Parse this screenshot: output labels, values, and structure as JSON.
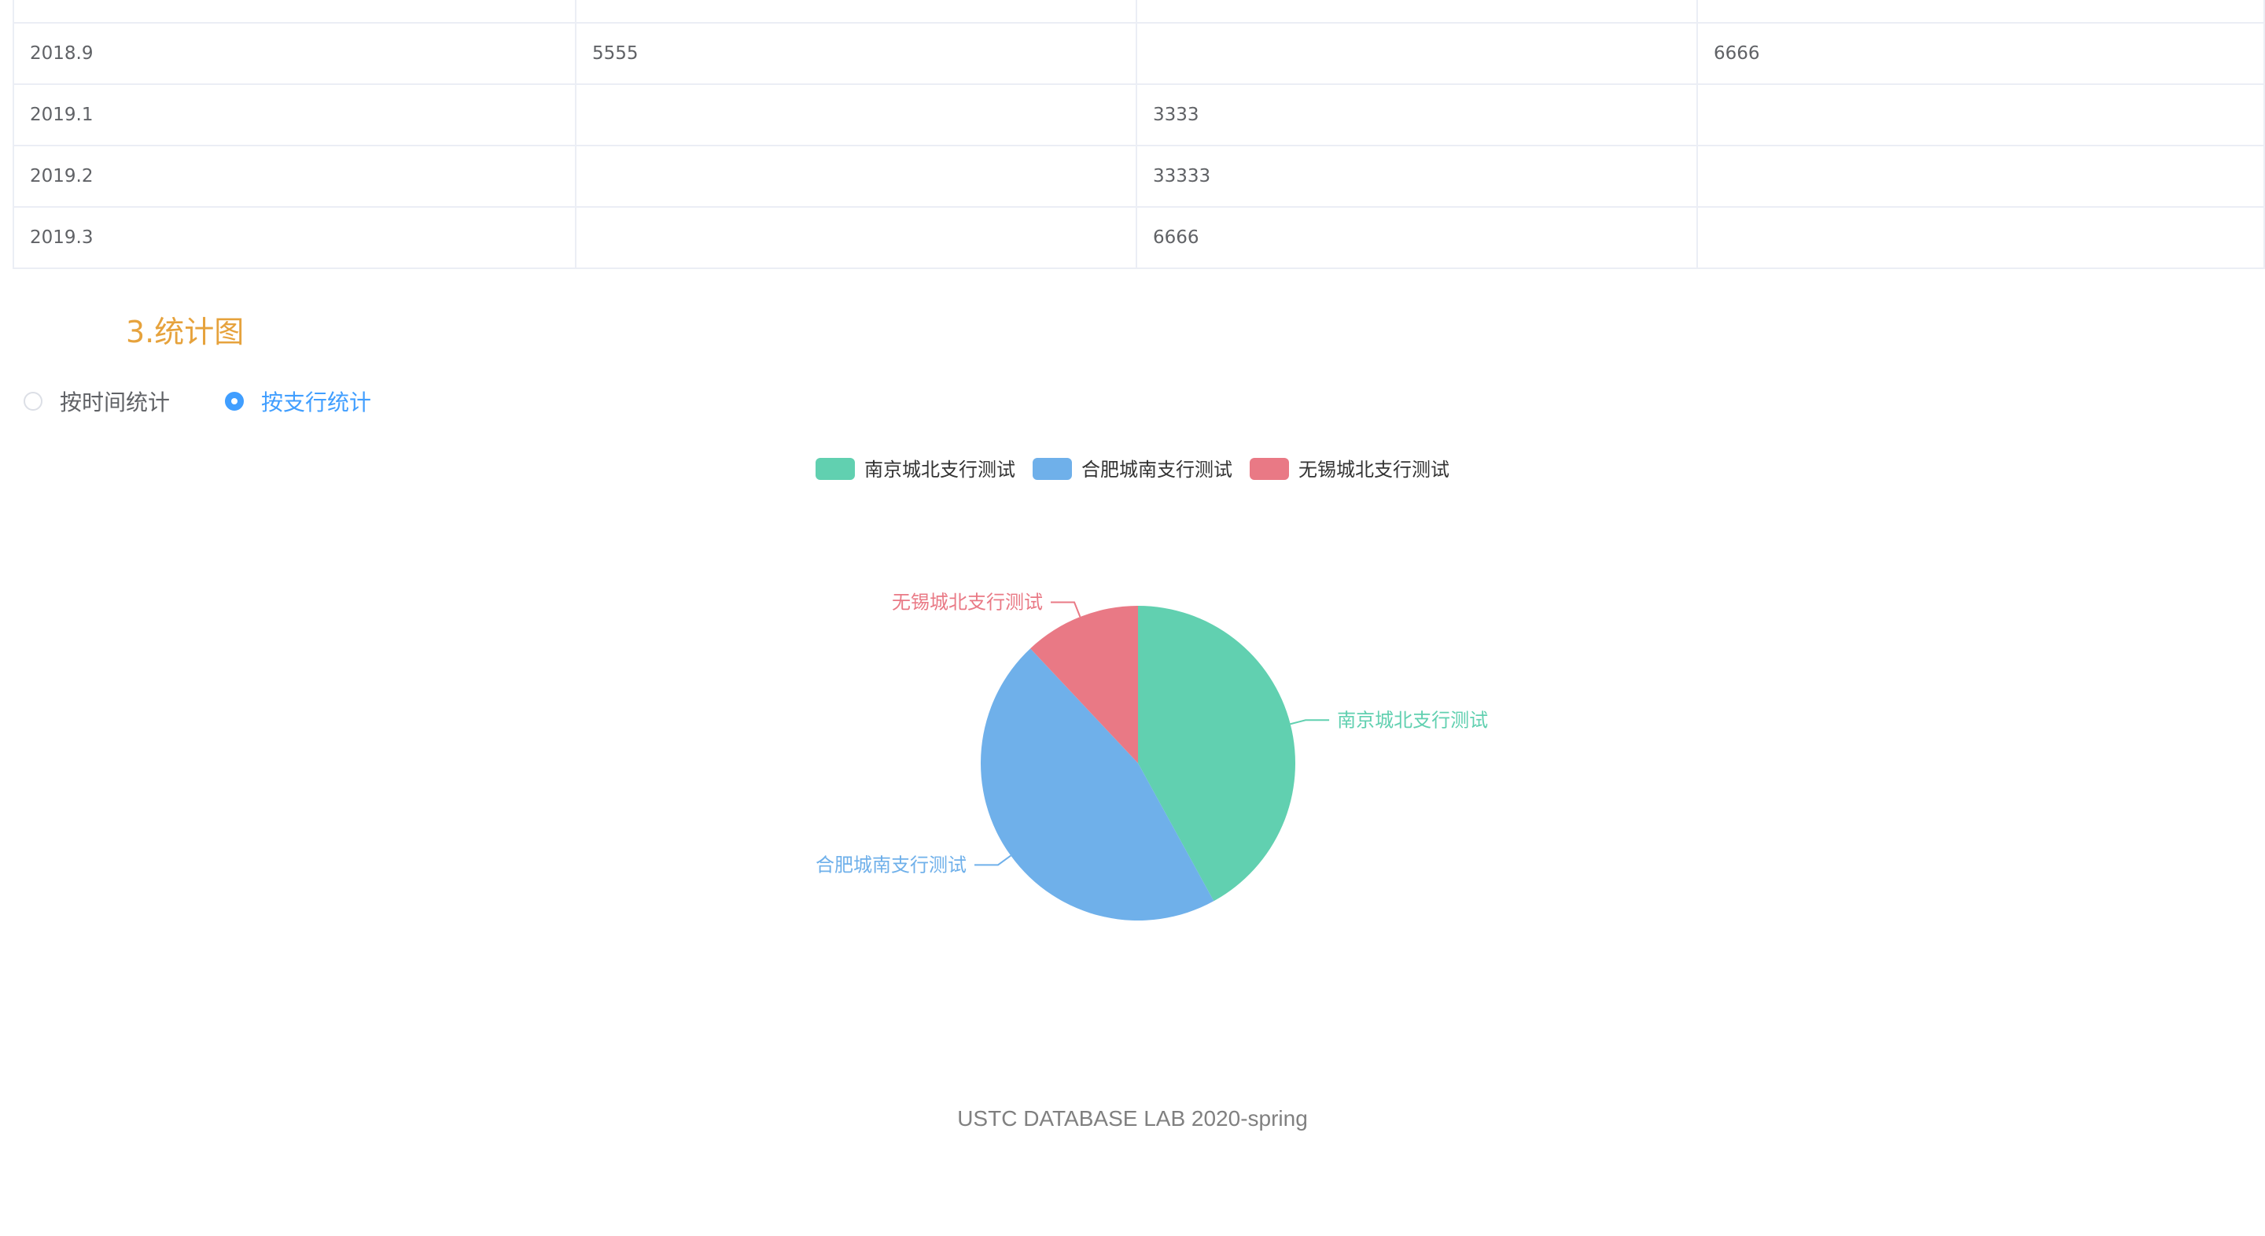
{
  "table": {
    "rows": [
      [
        "",
        "",
        "",
        ""
      ],
      [
        "2018.9",
        "5555",
        "",
        "6666"
      ],
      [
        "2019.1",
        "",
        "3333",
        ""
      ],
      [
        "2019.2",
        "",
        "33333",
        ""
      ],
      [
        "2019.3",
        "",
        "6666",
        ""
      ]
    ]
  },
  "section": {
    "title": "3.统计图"
  },
  "radios": [
    {
      "label": "按时间统计",
      "checked": false
    },
    {
      "label": "按支行统计",
      "checked": true
    }
  ],
  "chart_data": {
    "type": "pie",
    "legend_position": "top-center",
    "slices": [
      {
        "name": "南京城北支行测试",
        "value": 42,
        "color": "#61d0b0"
      },
      {
        "name": "合肥城南支行测试",
        "value": 46,
        "color": "#6fb0ea"
      },
      {
        "name": "无锡城北支行测试",
        "value": 12,
        "color": "#e97985"
      }
    ]
  },
  "footer": {
    "text": "USTC DATABASE LAB 2020-spring"
  }
}
